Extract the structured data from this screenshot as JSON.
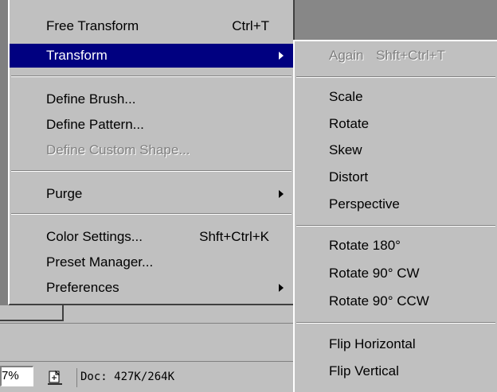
{
  "main_menu": {
    "items": [
      {
        "label": "Free Transform",
        "shortcut": "Ctrl+T"
      },
      {
        "label": "Transform"
      },
      {
        "label": "Define Brush..."
      },
      {
        "label": "Define Pattern..."
      },
      {
        "label": "Define Custom Shape..."
      },
      {
        "label": "Purge"
      },
      {
        "label": "Color Settings...",
        "shortcut": "Shft+Ctrl+K"
      },
      {
        "label": "Preset Manager..."
      },
      {
        "label": "Preferences"
      }
    ]
  },
  "submenu": {
    "items": [
      {
        "label": "Again",
        "shortcut": "Shft+Ctrl+T"
      },
      {
        "label": "Scale"
      },
      {
        "label": "Rotate"
      },
      {
        "label": "Skew"
      },
      {
        "label": "Distort"
      },
      {
        "label": "Perspective"
      },
      {
        "label": "Rotate 180°"
      },
      {
        "label": "Rotate 90° CW"
      },
      {
        "label": "Rotate 90° CCW"
      },
      {
        "label": "Flip Horizontal"
      },
      {
        "label": "Flip Vertical"
      }
    ]
  },
  "status": {
    "zoom": "7%",
    "doc_info": "Doc: 427K/264K",
    "icon": "document-info-icon"
  },
  "colors": {
    "menu_bg": "#c0c0c0",
    "highlight": "#000080",
    "workspace": "#808080"
  }
}
